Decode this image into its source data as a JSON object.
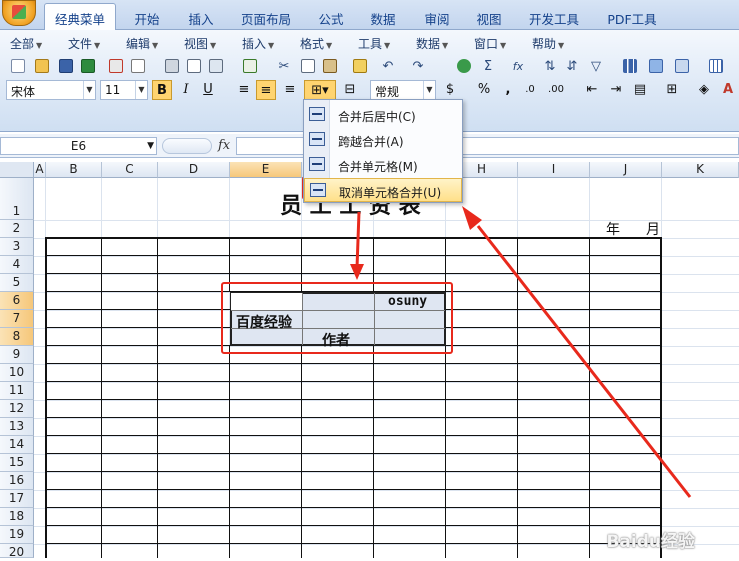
{
  "tabs": [
    "经典菜单",
    "开始",
    "插入",
    "页面布局",
    "公式",
    "数据",
    "审阅",
    "视图",
    "开发工具",
    "PDF工具"
  ],
  "active_tab_index": 0,
  "menus": [
    "全部",
    "文件",
    "编辑",
    "视图",
    "插入",
    "格式",
    "工具",
    "数据",
    "窗口",
    "帮助"
  ],
  "font": {
    "name": "宋体",
    "size": "11",
    "number_format": "常规"
  },
  "format_buttons": {
    "bold": "B",
    "italic": "I",
    "underline": "U",
    "percent": "%",
    "comma": ",",
    "sum": "Σ",
    "fx": "fx"
  },
  "name_box": "E6",
  "fx_label": "fx",
  "columns": [
    "A",
    "B",
    "C",
    "D",
    "E",
    "F",
    "G",
    "H",
    "I",
    "J",
    "K"
  ],
  "rows": [
    "1",
    "2",
    "3",
    "4",
    "5",
    "6",
    "7",
    "8",
    "9",
    "10",
    "11",
    "12",
    "13",
    "14",
    "15",
    "16",
    "17",
    "18",
    "19",
    "20"
  ],
  "selected_column": "E",
  "selected_rows": [
    "6",
    "7",
    "8"
  ],
  "merge_menu": {
    "items": [
      {
        "label": "合并后居中(C)"
      },
      {
        "label": "跨越合并(A)"
      },
      {
        "label": "合并单元格(M)"
      },
      {
        "label": "取消单元格合并(U)"
      }
    ],
    "highlighted_index": 3
  },
  "sheet": {
    "title": "员  工  工  资  表",
    "year_label": "年",
    "month_label": "月",
    "cell_osuny": "osuny",
    "cell_baidu": "百度经验",
    "cell_author": "作者"
  },
  "watermark": "Baidu经验",
  "colors": {
    "accent_red": "#e8291c",
    "selection": "#f6c77a",
    "ribbon": "#dde8f6"
  }
}
